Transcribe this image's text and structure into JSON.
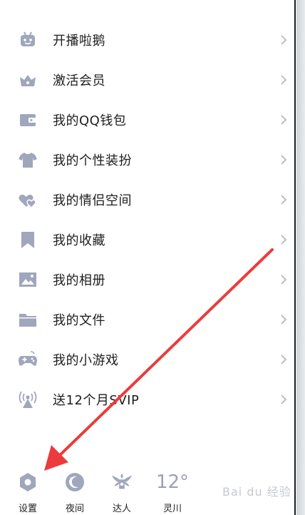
{
  "menu": {
    "items": [
      {
        "label": "开播啦鹅",
        "icon": "robot-tv-icon"
      },
      {
        "label": "激活会员",
        "icon": "crown-icon"
      },
      {
        "label": "我的QQ钱包",
        "icon": "wallet-icon"
      },
      {
        "label": "我的个性装扮",
        "icon": "tshirt-icon"
      },
      {
        "label": "我的情侣空间",
        "icon": "hearts-icon"
      },
      {
        "label": "我的收藏",
        "icon": "bookmark-icon"
      },
      {
        "label": "我的相册",
        "icon": "photo-icon"
      },
      {
        "label": "我的文件",
        "icon": "folder-icon"
      },
      {
        "label": "我的小游戏",
        "icon": "gamepad-icon"
      },
      {
        "label": "送12个月SVIP",
        "icon": "broadcast-icon"
      }
    ]
  },
  "bottom": {
    "settings": "设置",
    "night": "夜间",
    "expert": "达人",
    "weather_temp": "12°",
    "weather_city": "灵川"
  },
  "watermark": "Bai du 经验",
  "colors": {
    "icon": "#a0a6bb",
    "arrow": "#ec3b3b",
    "chevron": "#b5b8bf"
  }
}
